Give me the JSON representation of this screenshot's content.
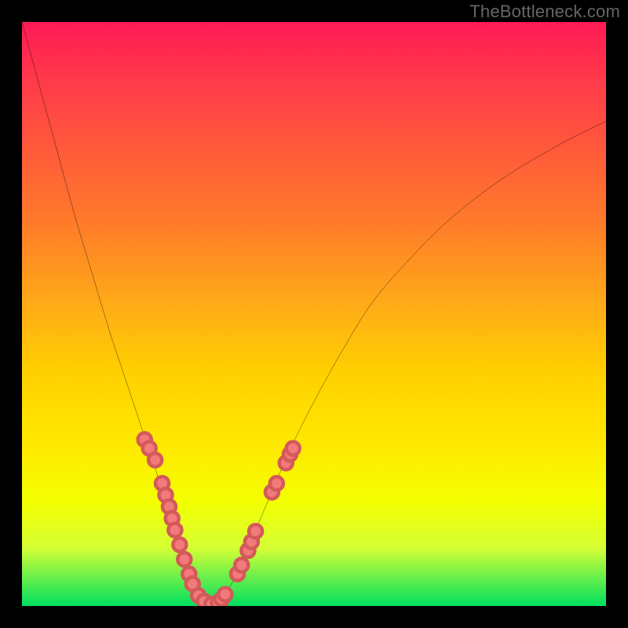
{
  "watermark": {
    "text": "TheBottleneck.com"
  },
  "chart_data": {
    "type": "line",
    "title": "",
    "xlabel": "",
    "ylabel": "",
    "xlim": [
      0,
      100
    ],
    "ylim": [
      0,
      100
    ],
    "series": [
      {
        "name": "bottleneck-curve",
        "x": [
          0,
          3,
          6,
          9,
          12,
          15,
          17,
          19,
          21,
          23,
          25,
          27,
          28,
          30,
          31,
          32.5,
          34,
          36,
          38,
          40,
          43,
          46,
          50,
          55,
          60,
          66,
          73,
          82,
          92,
          100
        ],
        "y": [
          100,
          89,
          78,
          67,
          57,
          47,
          41,
          35,
          29,
          23,
          17,
          11,
          8,
          3,
          1,
          0,
          1,
          4,
          8,
          13,
          20,
          27,
          35,
          44,
          52,
          59,
          66,
          73,
          79,
          83
        ]
      }
    ],
    "annotations": {
      "dots": [
        {
          "x": 21.0,
          "y": 28.5
        },
        {
          "x": 21.8,
          "y": 27.0
        },
        {
          "x": 22.8,
          "y": 25.0
        },
        {
          "x": 24.0,
          "y": 21.0
        },
        {
          "x": 24.6,
          "y": 19.0
        },
        {
          "x": 25.2,
          "y": 17.0
        },
        {
          "x": 25.7,
          "y": 15.0
        },
        {
          "x": 26.2,
          "y": 13.0
        },
        {
          "x": 27.0,
          "y": 10.5
        },
        {
          "x": 27.8,
          "y": 8.0
        },
        {
          "x": 28.6,
          "y": 5.5
        },
        {
          "x": 29.2,
          "y": 3.8
        },
        {
          "x": 30.2,
          "y": 1.8
        },
        {
          "x": 31.2,
          "y": 0.8
        },
        {
          "x": 32.5,
          "y": 0.3
        },
        {
          "x": 33.6,
          "y": 0.6
        },
        {
          "x": 34.2,
          "y": 1.2
        },
        {
          "x": 34.8,
          "y": 2.0
        },
        {
          "x": 36.9,
          "y": 5.5
        },
        {
          "x": 37.6,
          "y": 7.0
        },
        {
          "x": 38.7,
          "y": 9.5
        },
        {
          "x": 39.3,
          "y": 11.0
        },
        {
          "x": 40.0,
          "y": 12.8
        },
        {
          "x": 42.8,
          "y": 19.5
        },
        {
          "x": 43.6,
          "y": 21.0
        },
        {
          "x": 45.2,
          "y": 24.5
        },
        {
          "x": 45.9,
          "y": 26.0
        },
        {
          "x": 46.4,
          "y": 27.0
        }
      ]
    },
    "grid": false,
    "legend": false
  }
}
